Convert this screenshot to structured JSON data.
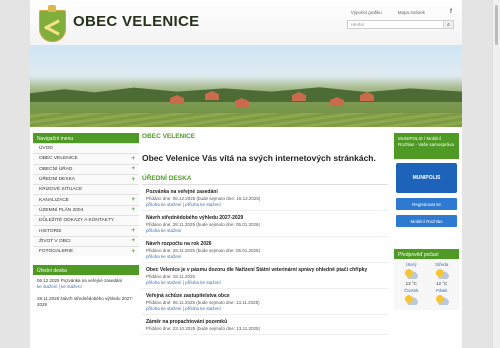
{
  "header": {
    "title": "OBEC VELENICE",
    "links": [
      "Výpočet grafiku",
      "Mapa stránek"
    ],
    "facebook": "f",
    "search_placeholder": "Hledat",
    "search_icon": "search-icon"
  },
  "left_nav": {
    "title": "Navigační menu",
    "items": [
      {
        "label": "ÚVOD",
        "has_plus": false
      },
      {
        "label": "OBEC VELENICE",
        "has_plus": true
      },
      {
        "label": "OBECNÍ ÚŘAD",
        "has_plus": true
      },
      {
        "label": "ÚŘEDNÍ DESKA",
        "has_plus": true
      },
      {
        "label": "KRIZOVÉ SITUACE",
        "has_plus": false
      },
      {
        "label": "KANALIZACE",
        "has_plus": true
      },
      {
        "label": "ÚZEMNÍ PLÁN 2004",
        "has_plus": true
      },
      {
        "label": "DŮLEŽITÉ ODKAZY A KONTAKTY",
        "has_plus": false
      },
      {
        "label": "HISTORIE",
        "has_plus": true
      },
      {
        "label": "ŽIVOT V OBCI",
        "has_plus": true
      },
      {
        "label": "FOTOGALERIE",
        "has_plus": true
      }
    ]
  },
  "news_box": {
    "title": "Úřední deska",
    "items": [
      {
        "text": "06.12.2025 Pozvánka na veřejné zasedání",
        "links": "ke stažení | ke stažení"
      },
      {
        "text": "28.11.2025 Návrh střednědobého výhledu 2027-2029",
        "links": ""
      }
    ]
  },
  "main": {
    "breadcrumb": "OBEC VELENICE",
    "heading": "Obec Velenice Vás vítá na svých internetových stránkách.",
    "section": "ÚŘEDNÍ DESKA",
    "items": [
      {
        "title": "Pozvánka na veřejné zasedání",
        "date": "Přidáno dne: 06.12.2025 (bude sejmuto dne: 16.12.2025)",
        "links": "příloha ke stažení | příloha ke stažení"
      },
      {
        "title": "Návrh střednědobého výhledu 2027-2029",
        "date": "Přidáno dne: 28.11.2025 (bude sejmuto dne: 05.01.2026)",
        "links": "příloha ke stažení"
      },
      {
        "title": "Návrh rozpočtu na rok 2026",
        "date": "Přidáno dne: 28.11.2025 (bude sejmuto dne: 05.01.2026)",
        "links": "příloha ke stažení"
      },
      {
        "title": "Obec Velenice je v pásmu dozoru dle Nařízení Státní veterinární správy ohledně ptačí chřipky",
        "date": "Přidáno dne: 19.11.2025",
        "links": "příloha ke stažení | příloha ke stažení"
      },
      {
        "title": "Veřejná schůze zastupitelstva obce",
        "date": "Přidáno dne: 06.11.2025 (bude sejmuto dne: 13.11.2025)",
        "links": "příloha ke stažení | příloha ke stažení"
      },
      {
        "title": "Záměr na propachtování pozemků",
        "date": "Přidáno dne: 23.10.2025 (bude sejmuto dne: 13.11.2025)",
        "links": ""
      }
    ]
  },
  "right": {
    "munipolis_title": "MUNIPOLIS / Mobilní Rozhlas - Vaše samospráva",
    "munipolis_logo": "MUNIPOLIS",
    "register_btn": "Registrovat se",
    "app_btn": "Mobilní Rozhlas",
    "weather_title": "Předpověď počasí",
    "weather": [
      {
        "day": "Úterý",
        "temp": "13 °C"
      },
      {
        "day": "Středa",
        "temp": "12 °C"
      },
      {
        "day": "Čtvrtek",
        "temp": ""
      },
      {
        "day": "Pátek",
        "temp": ""
      }
    ]
  }
}
